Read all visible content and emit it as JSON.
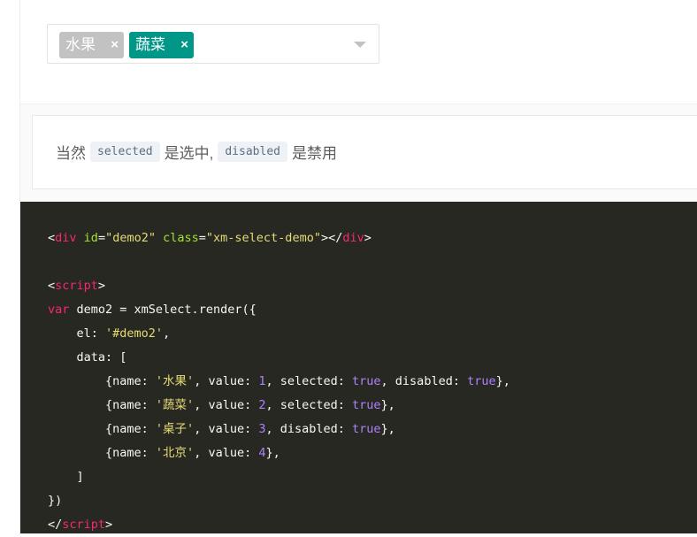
{
  "select": {
    "tags": [
      {
        "label": "水果",
        "close": "×",
        "color": "#c2c2c2"
      },
      {
        "label": "蔬菜",
        "close": "×",
        "color": "#009688"
      }
    ],
    "arrow_icon": "triangle-down"
  },
  "note": {
    "text1": "当然",
    "code1": "selected",
    "text2": "是选中,",
    "code2": "disabled",
    "text3": "是禁用"
  },
  "code_lines": [
    [
      {
        "t": "<",
        "c": ""
      },
      {
        "t": "div",
        "c": "tag"
      },
      {
        "t": " ",
        "c": ""
      },
      {
        "t": "id",
        "c": "attr"
      },
      {
        "t": "=",
        "c": ""
      },
      {
        "t": "\"demo2\"",
        "c": "str"
      },
      {
        "t": " ",
        "c": ""
      },
      {
        "t": "class",
        "c": "attr"
      },
      {
        "t": "=",
        "c": ""
      },
      {
        "t": "\"xm-select-demo\"",
        "c": "str"
      },
      {
        "t": "></",
        "c": ""
      },
      {
        "t": "div",
        "c": "tag"
      },
      {
        "t": ">",
        "c": ""
      }
    ],
    [],
    [
      {
        "t": "<",
        "c": ""
      },
      {
        "t": "script",
        "c": "tag"
      },
      {
        "t": ">",
        "c": ""
      }
    ],
    [
      {
        "t": "var",
        "c": "kw"
      },
      {
        "t": " demo2 = xmSelect.render({",
        "c": ""
      }
    ],
    [
      {
        "t": "    el: ",
        "c": ""
      },
      {
        "t": "'#demo2'",
        "c": "str"
      },
      {
        "t": ",",
        "c": ""
      }
    ],
    [
      {
        "t": "    data: [",
        "c": ""
      }
    ],
    [
      {
        "t": "        {name: ",
        "c": ""
      },
      {
        "t": "'水果'",
        "c": "str"
      },
      {
        "t": ", value: ",
        "c": ""
      },
      {
        "t": "1",
        "c": "num"
      },
      {
        "t": ", selected: ",
        "c": ""
      },
      {
        "t": "true",
        "c": "bool"
      },
      {
        "t": ", disabled: ",
        "c": ""
      },
      {
        "t": "true",
        "c": "bool"
      },
      {
        "t": "},",
        "c": ""
      }
    ],
    [
      {
        "t": "        {name: ",
        "c": ""
      },
      {
        "t": "'蔬菜'",
        "c": "str"
      },
      {
        "t": ", value: ",
        "c": ""
      },
      {
        "t": "2",
        "c": "num"
      },
      {
        "t": ", selected: ",
        "c": ""
      },
      {
        "t": "true",
        "c": "bool"
      },
      {
        "t": "},",
        "c": ""
      }
    ],
    [
      {
        "t": "        {name: ",
        "c": ""
      },
      {
        "t": "'桌子'",
        "c": "str"
      },
      {
        "t": ", value: ",
        "c": ""
      },
      {
        "t": "3",
        "c": "num"
      },
      {
        "t": ", disabled: ",
        "c": ""
      },
      {
        "t": "true",
        "c": "bool"
      },
      {
        "t": "},",
        "c": ""
      }
    ],
    [
      {
        "t": "        {name: ",
        "c": ""
      },
      {
        "t": "'北京'",
        "c": "str"
      },
      {
        "t": ", value: ",
        "c": ""
      },
      {
        "t": "4",
        "c": "num"
      },
      {
        "t": "},",
        "c": ""
      }
    ],
    [
      {
        "t": "    ]",
        "c": ""
      }
    ],
    [
      {
        "t": "})",
        "c": ""
      }
    ],
    [
      {
        "t": "</",
        "c": ""
      },
      {
        "t": "script",
        "c": "tag"
      },
      {
        "t": ">",
        "c": ""
      }
    ]
  ]
}
